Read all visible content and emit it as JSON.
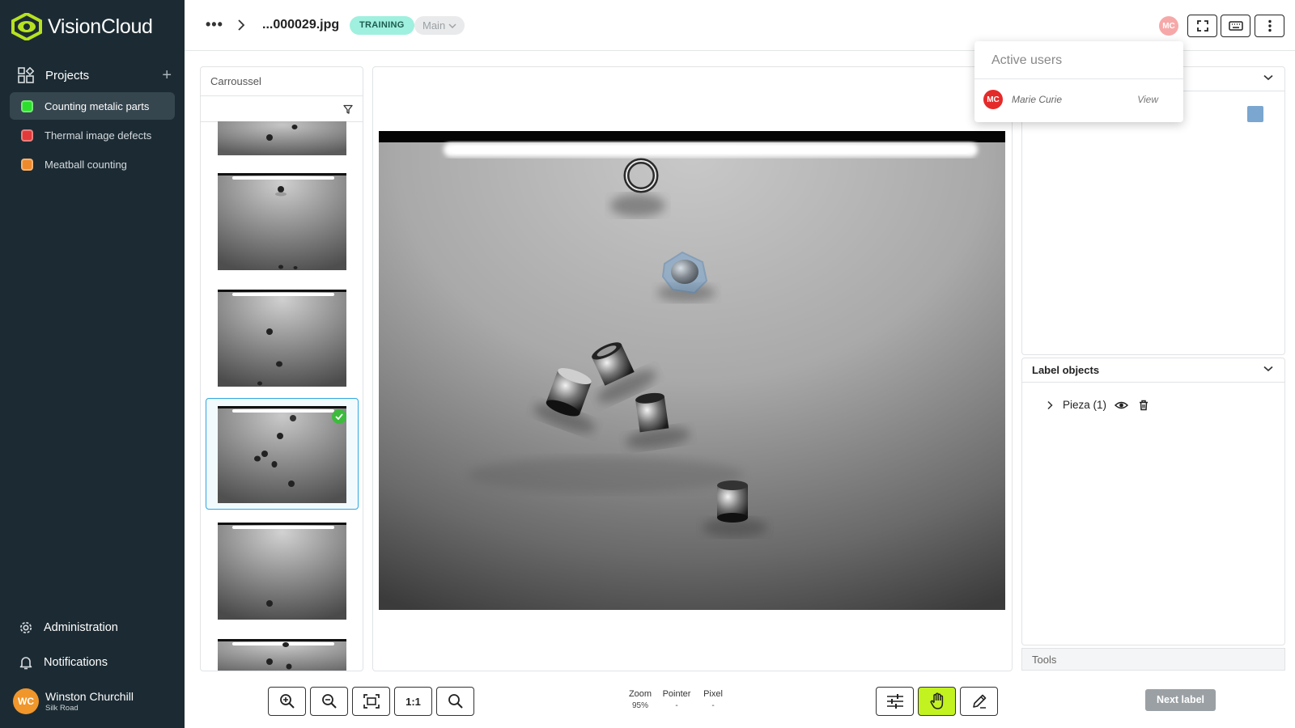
{
  "app": {
    "name": "VisionCloud"
  },
  "sidebar": {
    "projects_label": "Projects",
    "projects": [
      {
        "name": "Counting metalic parts",
        "color": "#2ddf2d",
        "active": true
      },
      {
        "name": "Thermal image defects",
        "color": "#e23a3a",
        "active": false
      },
      {
        "name": "Meatball counting",
        "color": "#ee8a2c",
        "active": false
      }
    ],
    "administration_label": "Administration",
    "notifications_label": "Notifications",
    "user": {
      "initials": "WC",
      "name": "Winston Churchill",
      "org": "Silk Road"
    }
  },
  "header": {
    "file_name": "...000029.jpg",
    "status_badge": "TRAINING",
    "branch": "Main",
    "active_user_initials": "MC"
  },
  "carousel": {
    "title": "Carroussel"
  },
  "active_users": {
    "title": "Active users",
    "users": [
      {
        "initials": "MC",
        "name": "Marie Curie",
        "action": "View"
      }
    ]
  },
  "label_objects": {
    "title": "Label objects",
    "items": [
      {
        "label": "Pieza (1)"
      }
    ]
  },
  "tools": {
    "title": "Tools"
  },
  "toolbar": {
    "one_to_one_label": "1:1",
    "zoom_label": "Zoom",
    "zoom_value": "95%",
    "pointer_label": "Pointer",
    "pointer_value": "-",
    "pixel_label": "Pixel",
    "pixel_value": "-",
    "next_label": "Next label"
  },
  "colors": {
    "sidebar_bg": "#1c2b33",
    "brand_accent": "#b6e21f",
    "training_badge": "#9ff0de",
    "active_tool": "#c2f21f",
    "selection_border": "#2ea7e0",
    "annotation_fill": "#7aa6cf"
  }
}
